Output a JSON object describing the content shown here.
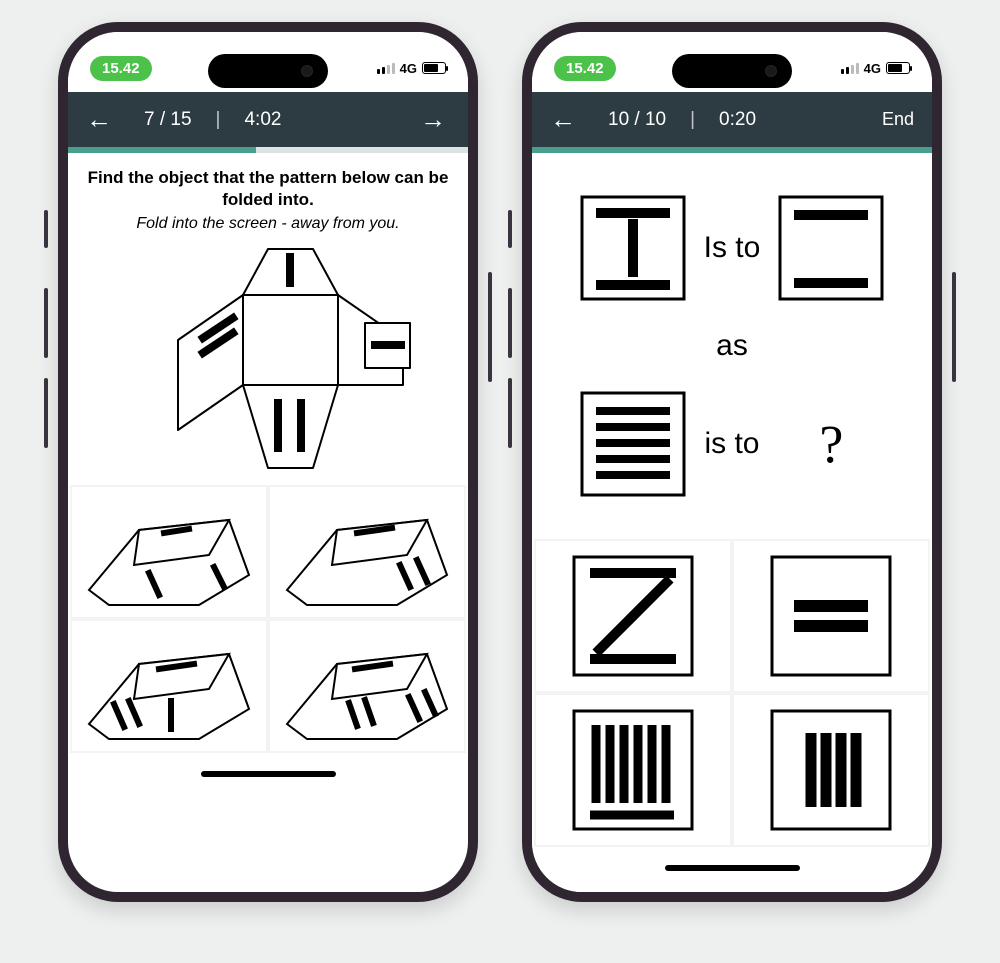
{
  "left": {
    "status": {
      "time": "15.42",
      "net": "4G"
    },
    "nav": {
      "counter": "7 / 15",
      "sep": "|",
      "timer": "4:02"
    },
    "progress_pct": 47,
    "question": "Find the object that the pattern below can be folded into.",
    "hint": "Fold into the screen - away from you."
  },
  "right": {
    "status": {
      "time": "15.42",
      "net": "4G"
    },
    "nav": {
      "counter": "10 / 10",
      "sep": "|",
      "timer": "0:20",
      "end": "End"
    },
    "progress_pct": 100,
    "analogy": {
      "is_to": "Is to",
      "as": "as",
      "is_to2": "is to",
      "qmark": "?"
    }
  }
}
